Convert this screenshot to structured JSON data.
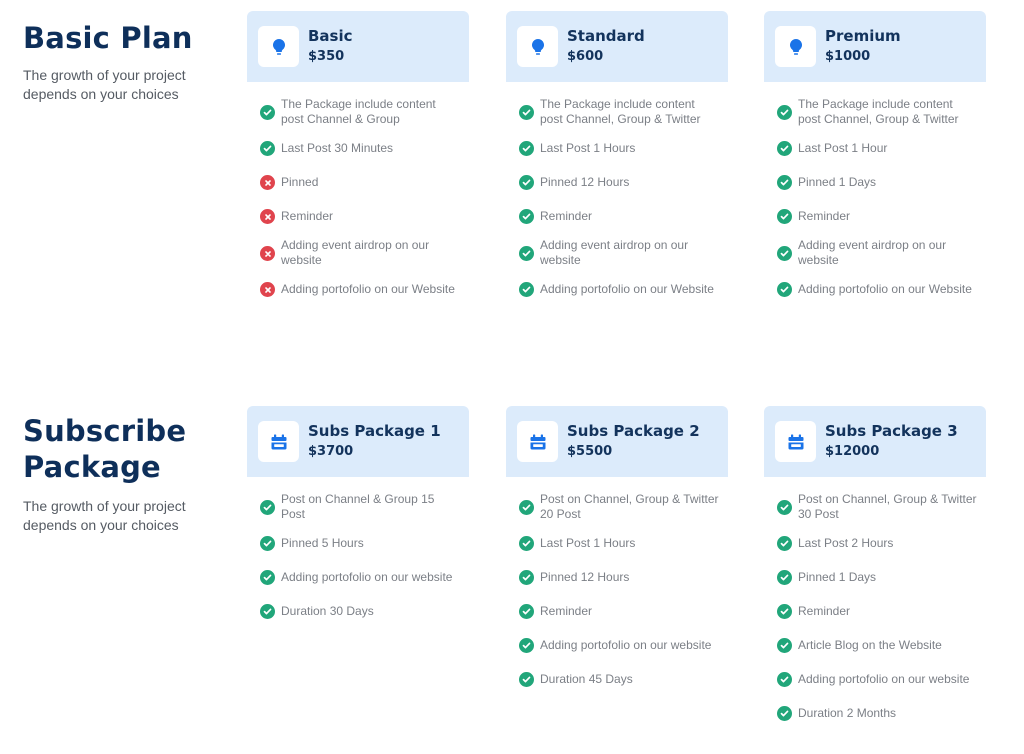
{
  "colors": {
    "heading": "#0e2f5a",
    "card_header_bg": "#dcebfb",
    "icon_blue": "#1a73e8",
    "check_green": "#21a67a",
    "cross_red": "#e0444d"
  },
  "basic_plan": {
    "title": "Basic Plan",
    "subtitle": "The growth of your project depends on your choices",
    "cards": [
      {
        "icon": "lightbulb-icon",
        "name": "Basic",
        "price": "$350",
        "features": [
          {
            "text": "The Package include content post Channel & Group",
            "included": true
          },
          {
            "text": "Last Post 30 Minutes",
            "included": true
          },
          {
            "text": "Pinned",
            "included": false
          },
          {
            "text": "Reminder",
            "included": false
          },
          {
            "text": "Adding event airdrop on our website",
            "included": false
          },
          {
            "text": "Adding portofolio on our Website",
            "included": false
          }
        ]
      },
      {
        "icon": "lightbulb-icon",
        "name": "Standard",
        "price": "$600",
        "features": [
          {
            "text": "The Package include content post Channel, Group & Twitter",
            "included": true
          },
          {
            "text": "Last Post 1 Hours",
            "included": true
          },
          {
            "text": "Pinned 12 Hours",
            "included": true
          },
          {
            "text": "Reminder",
            "included": true
          },
          {
            "text": "Adding event airdrop on our website",
            "included": true
          },
          {
            "text": "Adding portofolio on our Website",
            "included": true
          }
        ]
      },
      {
        "icon": "lightbulb-icon",
        "name": "Premium",
        "price": "$1000",
        "features": [
          {
            "text": "The Package include content post Channel, Group & Twitter",
            "included": true
          },
          {
            "text": "Last Post 1 Hour",
            "included": true
          },
          {
            "text": "Pinned 1 Days",
            "included": true
          },
          {
            "text": "Reminder",
            "included": true
          },
          {
            "text": "Adding event airdrop on our website",
            "included": true
          },
          {
            "text": "Adding portofolio on our Website",
            "included": true
          }
        ]
      }
    ]
  },
  "subscribe_package": {
    "title": "Subscribe Package",
    "subtitle": "The growth of your project depends on your choices",
    "cards": [
      {
        "icon": "calendar-icon",
        "name": "Subs Package 1",
        "price": "$3700",
        "features": [
          {
            "text": "Post on Channel & Group 15 Post",
            "included": true
          },
          {
            "text": "Pinned 5 Hours",
            "included": true
          },
          {
            "text": "Adding portofolio on our website",
            "included": true
          },
          {
            "text": "Duration 30 Days",
            "included": true
          }
        ]
      },
      {
        "icon": "calendar-icon",
        "name": "Subs Package 2",
        "price": "$5500",
        "features": [
          {
            "text": "Post on Channel, Group & Twitter 20 Post",
            "included": true
          },
          {
            "text": "Last Post 1 Hours",
            "included": true
          },
          {
            "text": "Pinned 12 Hours",
            "included": true
          },
          {
            "text": "Reminder",
            "included": true
          },
          {
            "text": "Adding portofolio on our website",
            "included": true
          },
          {
            "text": "Duration 45 Days",
            "included": true
          }
        ]
      },
      {
        "icon": "calendar-icon",
        "name": "Subs Package 3",
        "price": "$12000",
        "features": [
          {
            "text": "Post on Channel, Group & Twitter 30 Post",
            "included": true
          },
          {
            "text": "Last Post 2 Hours",
            "included": true
          },
          {
            "text": "Pinned 1 Days",
            "included": true
          },
          {
            "text": "Reminder",
            "included": true
          },
          {
            "text": "Article Blog on the Website",
            "included": true
          },
          {
            "text": "Adding portofolio on our website",
            "included": true
          },
          {
            "text": "Duration 2 Months",
            "included": true
          }
        ]
      }
    ]
  }
}
